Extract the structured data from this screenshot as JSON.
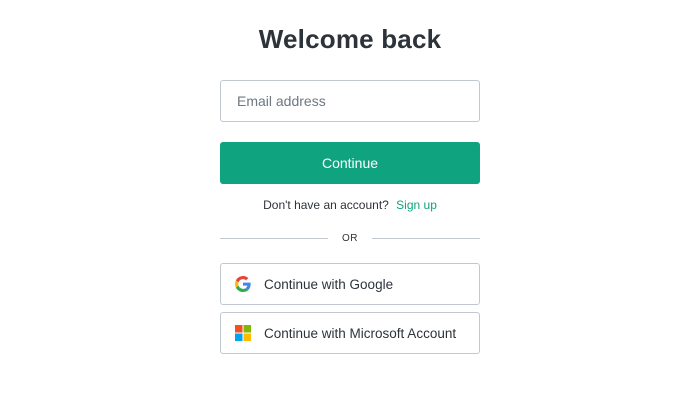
{
  "page": {
    "title": "Welcome back"
  },
  "form": {
    "email_placeholder": "Email address",
    "email_value": "",
    "continue_label": "Continue"
  },
  "signup": {
    "prompt": "Don't have an account?",
    "link_label": "Sign up"
  },
  "divider": {
    "label": "OR"
  },
  "social": {
    "google_label": "Continue with Google",
    "google_icon": "google-icon",
    "microsoft_label": "Continue with Microsoft Account",
    "microsoft_icon": "microsoft-icon"
  },
  "colors": {
    "accent": "#10a37f",
    "text": "#2d333a",
    "border": "#c2c8d0",
    "microsoft_red": "#f25022",
    "microsoft_green": "#7fba00",
    "microsoft_blue": "#00a4ef",
    "microsoft_yellow": "#ffb900"
  }
}
